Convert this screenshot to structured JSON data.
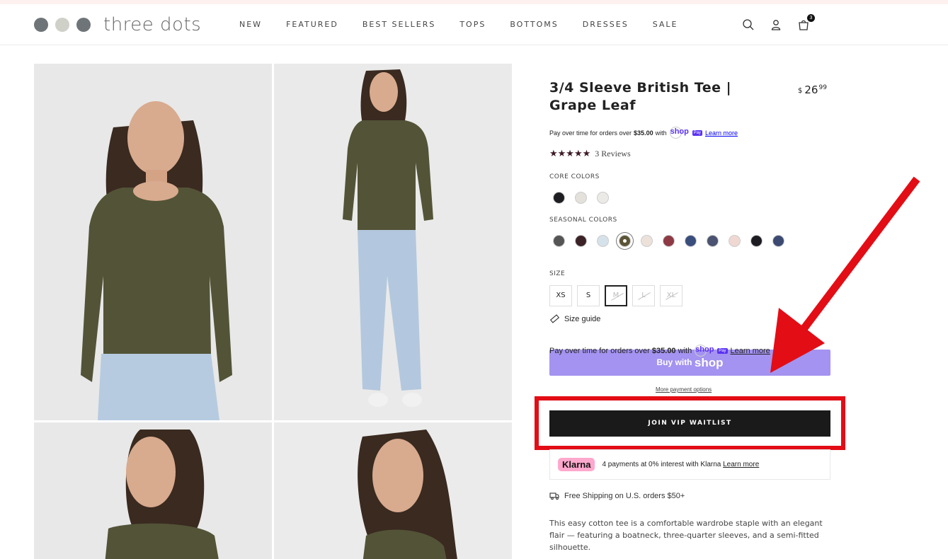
{
  "brand": {
    "name": "three dots",
    "dot_colors": [
      "#6e7478",
      "#cfd0c7",
      "#6e7478"
    ]
  },
  "nav": [
    "NEW",
    "FEATURED",
    "BEST SELLERS",
    "TOPS",
    "BOTTOMS",
    "DRESSES",
    "SALE"
  ],
  "header_icons": {
    "search": "search-icon",
    "account": "user-icon",
    "cart": "bag-icon",
    "cart_count": "3"
  },
  "product": {
    "title": "3/4 Sleeve British Tee | Grape Leaf",
    "price": {
      "currency": "$",
      "whole": "26",
      "cents": "99"
    },
    "pay_over": {
      "prefix": "Pay over time for orders over",
      "amount": "$35.00",
      "with": "with",
      "shop": "shop",
      "pay": "Pay",
      "learn": "Learn more"
    },
    "rating": {
      "stars": "★★★★★",
      "reviews": "3 Reviews"
    },
    "core_colors_label": "CORE COLORS",
    "core_colors": [
      "#1e1e22",
      "#e4e1db",
      "#eceae6"
    ],
    "seasonal_colors_label": "SEASONAL COLORS",
    "seasonal_colors": [
      "#555555",
      "#3b2226",
      "#d6e2ea",
      "#5b5436",
      "#ece2da",
      "#8e3a44",
      "#3a4e7c",
      "#4a5370",
      "#f0d8d2",
      "#1c1c22",
      "#3c4a72"
    ],
    "selected_seasonal": 3,
    "size_label": "SIZE",
    "sizes": [
      {
        "label": "XS",
        "state": "available"
      },
      {
        "label": "S",
        "state": "available"
      },
      {
        "label": "M",
        "state": "selected-unavailable"
      },
      {
        "label": "L",
        "state": "unavailable"
      },
      {
        "label": "XL",
        "state": "unavailable"
      }
    ],
    "size_guide": "Size guide",
    "buy_with": "Buy with",
    "buy_shop": "shop",
    "more_payment": "More payment options",
    "vip_button": "JOIN VIP WAITLIST",
    "klarna": {
      "logo": "Klarna",
      "text": "4 payments at 0% interest with Klarna",
      "learn": "Learn more"
    },
    "shipping": "Free Shipping on U.S. orders $50+",
    "description": "This easy cotton tee is a comfortable wardrobe staple with an elegant flair — featuring a boatneck, three-quarter sleeves, and a semi-fitted silhouette."
  },
  "annotation": {
    "highlight_color": "#e30d15"
  }
}
